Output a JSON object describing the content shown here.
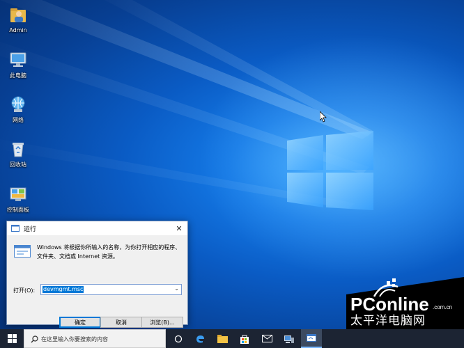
{
  "desktop": {
    "icons": [
      {
        "label": "Admin",
        "icon": "user-folder-icon"
      },
      {
        "label": "此电脑",
        "icon": "computer-icon"
      },
      {
        "label": "网络",
        "icon": "network-icon"
      },
      {
        "label": "回收站",
        "icon": "recycle-bin-icon"
      },
      {
        "label": "控制面板",
        "icon": "control-panel-icon"
      }
    ]
  },
  "run_dialog": {
    "title": "运行",
    "description": "Windows 将根据你所输入的名称，为你打开相应的程序、文件夹、文档或 Internet 资源。",
    "open_label": "打开(O):",
    "input_value": "devmgmt.msc",
    "ok_label": "确定",
    "cancel_label": "取消",
    "browse_label": "浏览(B)..."
  },
  "taskbar": {
    "search_placeholder": "在这里输入你要搜索的内容",
    "pinned": [
      "cortana-icon",
      "edge-icon",
      "file-explorer-icon",
      "store-icon",
      "mail-icon",
      "device-manager-icon",
      "media-icon",
      "run-icon"
    ]
  },
  "watermark": {
    "brand": "PConline",
    "domain": ".com.cn",
    "chinese": "太平洋电脑网"
  },
  "colors": {
    "accent": "#0078d7",
    "taskbar": "#1c2433",
    "desktop_blue": "#0a5bc4"
  }
}
